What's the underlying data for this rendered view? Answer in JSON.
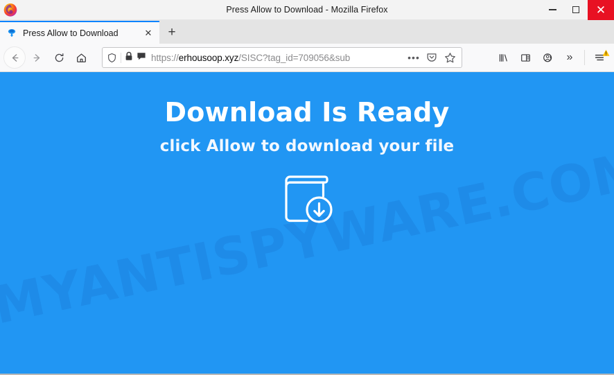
{
  "window": {
    "title": "Press Allow to Download - Mozilla Firefox",
    "logo_icon": "firefox-logo",
    "controls": {
      "minimize_label": "—",
      "maximize_label": "□",
      "close_label": "✕",
      "close_color": "#e81123"
    }
  },
  "tabs": {
    "items": [
      {
        "label": "Press Allow to Download",
        "favicon": "site-favicon",
        "close_label": "✕",
        "active": true
      }
    ],
    "new_tab_label": "+"
  },
  "toolbar": {
    "back_icon": "back-arrow-icon",
    "forward_icon": "forward-arrow-icon",
    "reload_icon": "reload-icon",
    "home_icon": "home-icon",
    "library_icon": "library-icon",
    "sidebar_icon": "sidebar-icon",
    "account_icon": "account-warning-icon",
    "overflow_label": "»",
    "menu_icon": "hamburger-menu-icon",
    "menu_badge_icon": "warning-badge-icon",
    "menu_badge_color": "#ffbf00"
  },
  "urlbar": {
    "identity_icon": "tracking-protection-shield-icon",
    "lock_icon": "padlock-icon",
    "permission_icon": "notification-permission-icon",
    "scheme": "https://",
    "host": "erhousoop.xyz",
    "path": "/SISC?tag_id=709056&sub",
    "full_url": "https://erhousoop.xyz/SISC?tag_id=709056&sub",
    "page_actions_label": "•••",
    "pocket_icon": "pocket-icon",
    "bookmark_icon": "star-bookmark-icon"
  },
  "page": {
    "background_color": "#2196F3",
    "headline": "Download Is Ready",
    "subheadline": "click Allow to download your file",
    "graphic_icon": "book-download-icon",
    "watermark": "MYANTISPYWARE.COM"
  }
}
